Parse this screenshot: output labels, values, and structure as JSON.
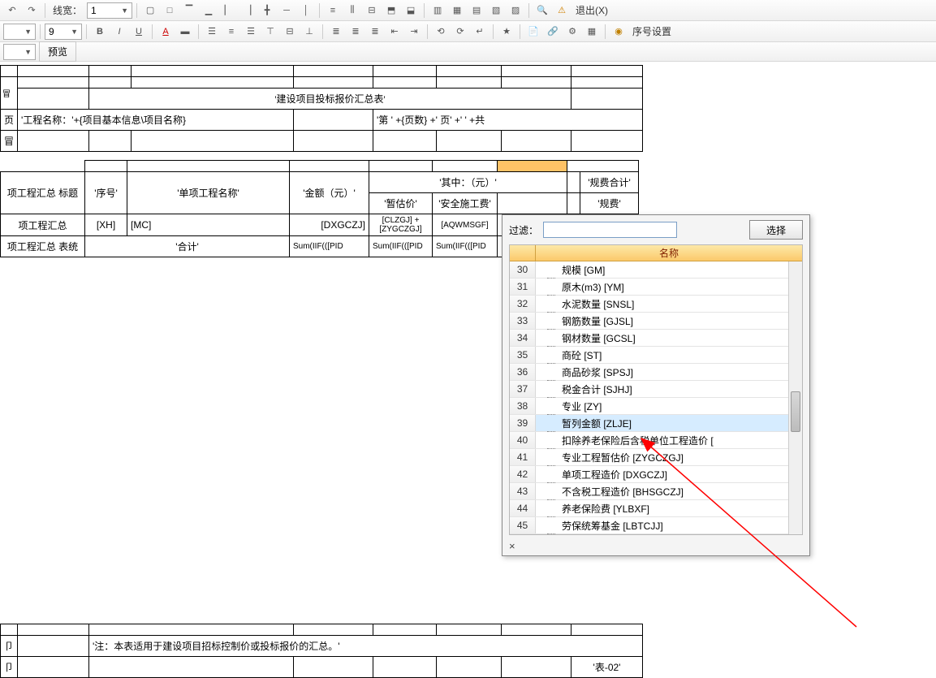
{
  "toolbar1": {
    "line_width_label": "线宽：",
    "line_width_value": "1",
    "exit_label": "退出(X)"
  },
  "toolbar2": {
    "font_size": "9",
    "seq_setting": "序号设置"
  },
  "tabs": {
    "preview": "预览"
  },
  "report": {
    "title": "'建设项目投标报价汇总表'",
    "proj_name_label": "'工程名称：'+{项目基本信息\\项目名称}",
    "page_expr": "'第  ' +{页数} +'  页' +'  ' +共",
    "row_head_title": "项工程汇总 标题",
    "row_head_data": "项工程汇总",
    "row_head_sum": "项工程汇总 表统",
    "col_seq": "'序号'",
    "col_name": "'单项工程名称'",
    "col_amount": "'金额（元）'",
    "col_sub_header": "'其中：（元）'",
    "col_est": "'暂估价'",
    "col_safe": "'安全施工费'",
    "col_fee_total": "'规费合计'",
    "col_fee": "'规费'",
    "d_seq": "[XH]",
    "d_name": "[MC]",
    "d_amount": "[DXGCZJ]",
    "d_est": "[CLZGJ] + [ZYGCZGJ]",
    "d_safe": "[AQWMSGF]",
    "sum_label": "'合计'",
    "sum_amount": "Sum(IIF(([PID",
    "sum_est": "Sum(IIF(([PID",
    "sum_safe": "Sum(IIF(([PID",
    "note": "'注：本表适用于建设项目招标控制价或投标报价的汇总。'",
    "sheet_code": "'表-02'",
    "footer_label": "卩"
  },
  "popup": {
    "filter_label": "过滤：",
    "select_btn": "选择",
    "header_name": "名称",
    "close": "×",
    "rows": [
      {
        "n": "30",
        "t": "规模 [GM]"
      },
      {
        "n": "31",
        "t": "原木(m3) [YM]"
      },
      {
        "n": "32",
        "t": "水泥数量 [SNSL]"
      },
      {
        "n": "33",
        "t": "钢筋数量 [GJSL]"
      },
      {
        "n": "34",
        "t": "钢材数量 [GCSL]"
      },
      {
        "n": "35",
        "t": "商砼 [ST]"
      },
      {
        "n": "36",
        "t": "商品砂浆 [SPSJ]"
      },
      {
        "n": "37",
        "t": "税金合计 [SJHJ]"
      },
      {
        "n": "38",
        "t": "专业 [ZY]"
      },
      {
        "n": "39",
        "t": "暂列金额 [ZLJE]",
        "hl": true
      },
      {
        "n": "40",
        "t": "扣除养老保险后含税单位工程造价 ["
      },
      {
        "n": "41",
        "t": "专业工程暂估价 [ZYGCZGJ]"
      },
      {
        "n": "42",
        "t": "单项工程造价 [DXGCZJ]"
      },
      {
        "n": "43",
        "t": "不含税工程造价 [BHSGCZJ]"
      },
      {
        "n": "44",
        "t": "养老保险费 [YLBXF]"
      },
      {
        "n": "45",
        "t": "劳保统筹基金 [LBTCJJ]"
      }
    ]
  }
}
